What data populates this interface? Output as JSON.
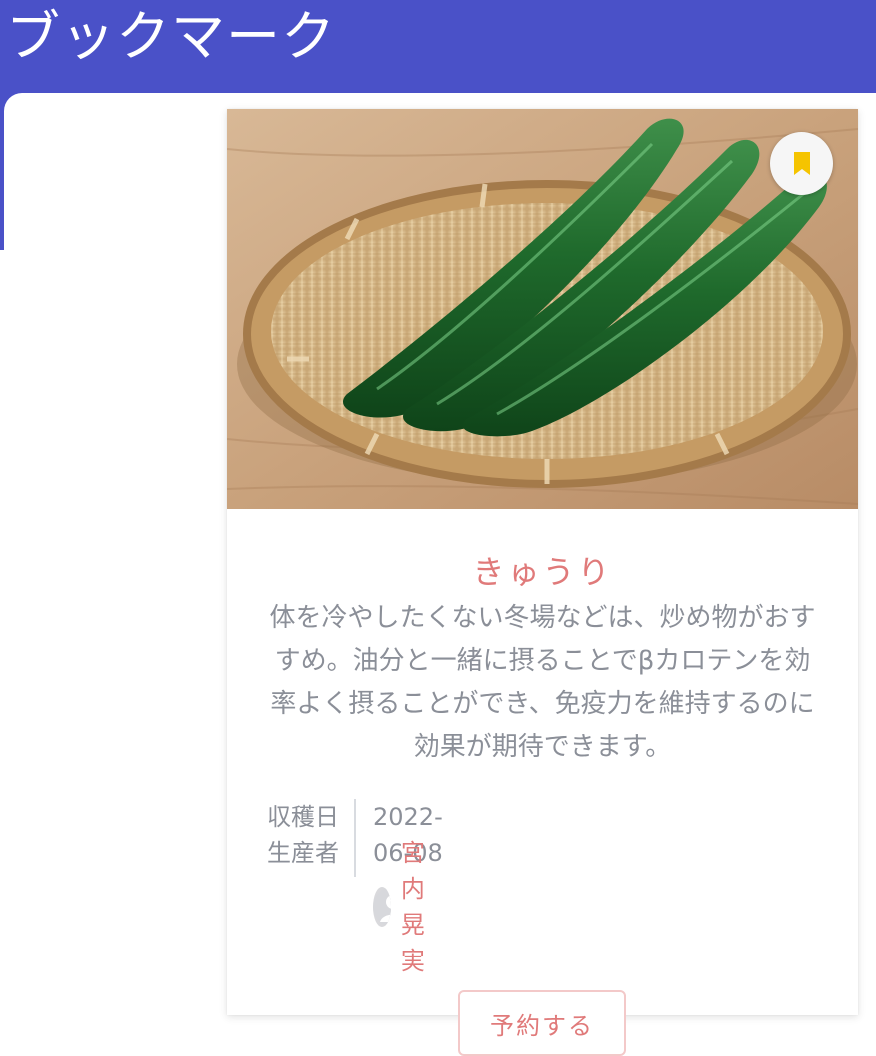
{
  "header": {
    "title": "ブックマーク"
  },
  "card": {
    "image_alt": "cucumbers-in-bamboo-basket",
    "bookmark_icon": "bookmark-icon",
    "name": "きゅうり",
    "description": "体を冷やしたくない冬場などは、炒め物がおすすめ。油分と一緒に摂ることでβカロテンを効率よく摂ることができ、免疫力を維持するのに効果が期待できます。",
    "harvest_label": "収穫日",
    "harvest_date": "2022-06-08",
    "producer_label": "生産者",
    "producer_name": "宮内 晃実",
    "reserve_label": "予約する"
  },
  "colors": {
    "header_bg": "#4a51c8",
    "accent": "#e07a7a",
    "bookmark": "#f5c400",
    "text_muted": "#8b8f98"
  }
}
